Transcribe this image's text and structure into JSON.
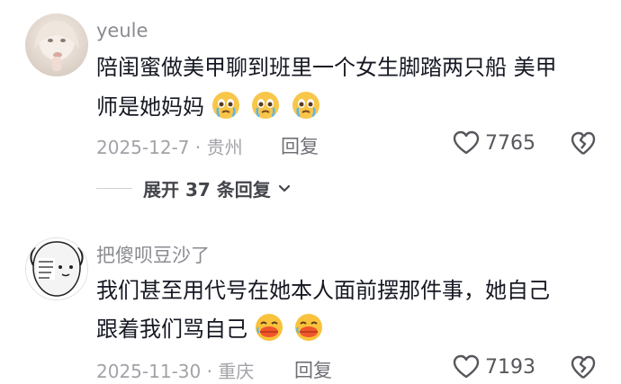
{
  "comments": [
    {
      "username": "yeule",
      "text_line1": "陪闺蜜做美甲聊到班里一个女生脚踏两只船 美甲",
      "text_line2": "师是她妈妈",
      "emojis": [
        "crying-face-emoji",
        "crying-face-emoji",
        "crying-face-emoji"
      ],
      "date_location": "2025-12-7 · 贵州",
      "reply_label": "回复",
      "like_count": "7765",
      "expand_label": "展开 37 条回复"
    },
    {
      "username": "把傻呗豆沙了",
      "text_line1": "我们甚至用代号在她本人面前摆那件事，她自己",
      "text_line2": "跟着我们骂自己",
      "emojis": [
        "laughing-duck-emoji",
        "laughing-duck-emoji"
      ],
      "date_location": "2025-11-30 · 重庆",
      "reply_label": "回复",
      "like_count": "7193"
    }
  ],
  "colors": {
    "text": "#161823",
    "username": "#8a8b91",
    "meta": "#a2a3a8",
    "icon": "#56575c"
  }
}
